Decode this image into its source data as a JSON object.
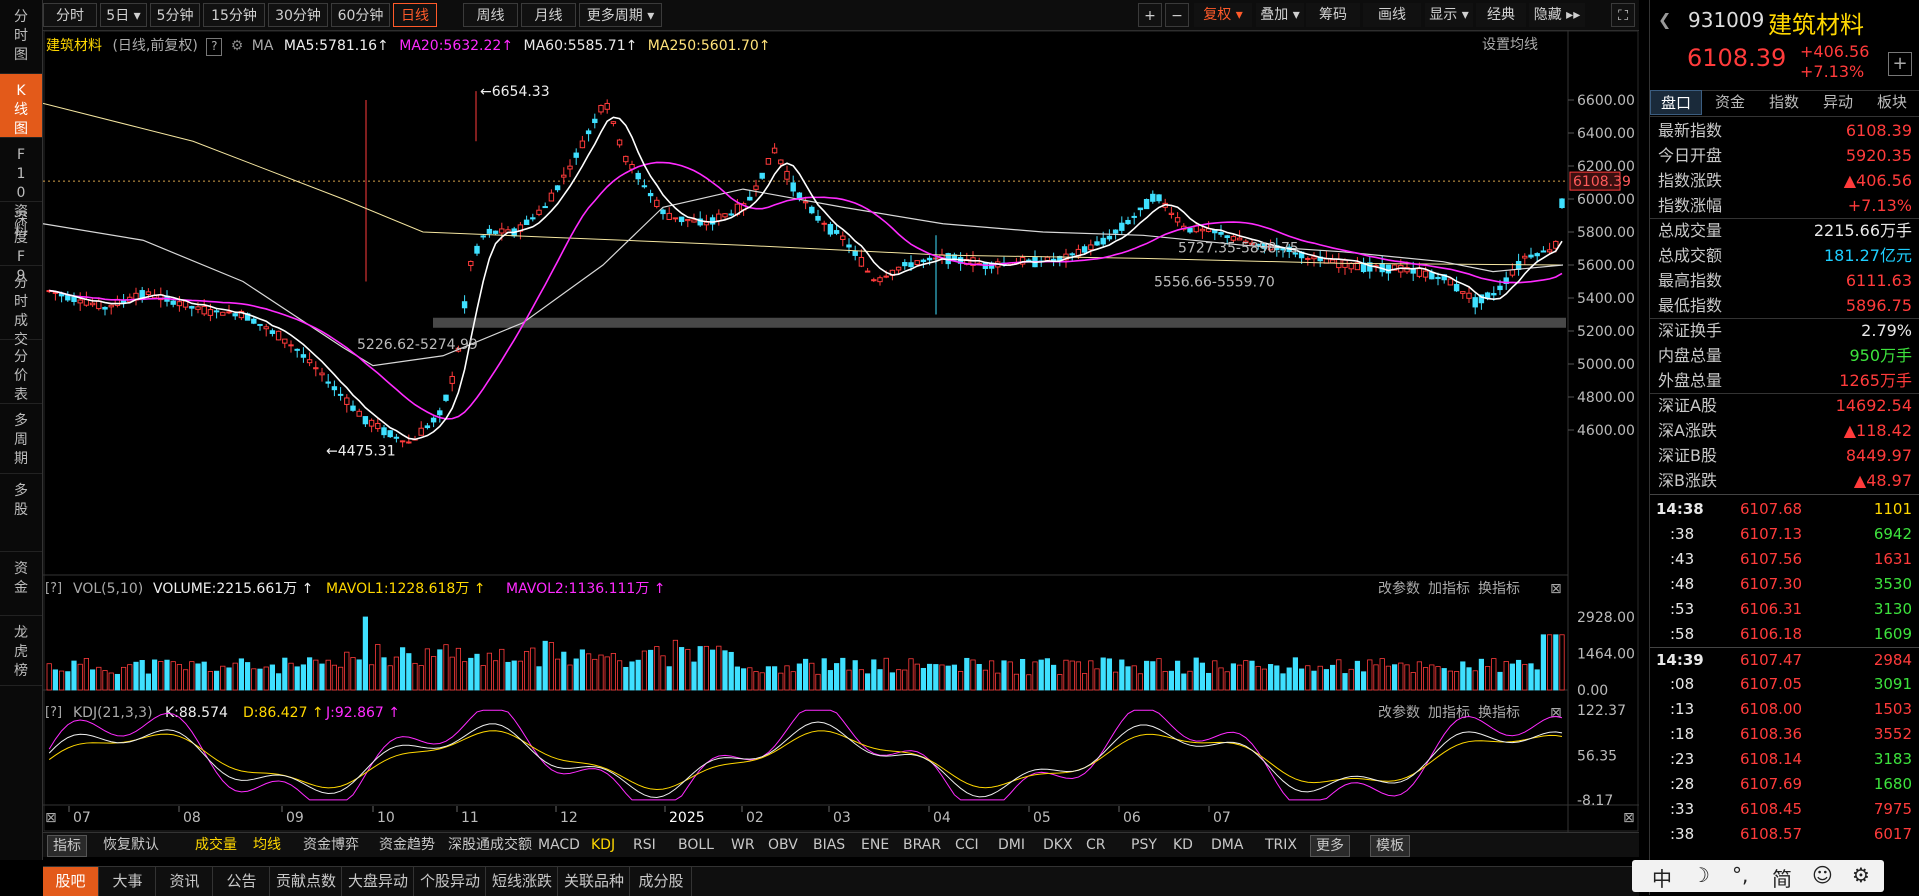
{
  "leftnav": [
    {
      "label": "分时图",
      "active": false
    },
    {
      "label": "K线图",
      "active": true
    },
    {
      "label": "F10资料",
      "active": false
    },
    {
      "label": "深度F9",
      "active": false
    },
    {
      "label": "分时成交",
      "active": false
    },
    {
      "label": "分价表",
      "active": false
    },
    {
      "label": "多周期",
      "active": false
    },
    {
      "label": "多股",
      "active": false
    },
    {
      "label": "资金",
      "active": false
    },
    {
      "label": "龙虎榜",
      "active": false
    }
  ],
  "toolbar": {
    "periods": [
      "分时",
      "5日",
      "5分钟",
      "15分钟",
      "30分钟",
      "60分钟",
      "日线",
      "周线",
      "月线",
      "更多周期"
    ],
    "active_period": "日线",
    "right": [
      "复权",
      "叠加",
      "筹码",
      "画线",
      "显示",
      "经典",
      "隐藏"
    ]
  },
  "header": {
    "name": "建筑材料",
    "mode": "(日线,前复权)",
    "ma_label": "MA",
    "ma5": "MA5:5781.16",
    "ma20": "MA20:5632.22",
    "ma60": "MA60:5585.71",
    "ma250": "MA250:5601.70",
    "set_ma": "设置均线"
  },
  "price_axis": [
    "6600.00",
    "6400.00",
    "6200.00",
    "6000.00",
    "5800.00",
    "5600.00",
    "5400.00",
    "5200.00",
    "5000.00",
    "4800.00",
    "4600.00"
  ],
  "current_price_tag": "6108.39",
  "annotations": {
    "high": "6654.33",
    "low": "4475.31",
    "zone": "5226.62-5274.99",
    "band1": "5727.35-5898.75",
    "band2": "5556.66-5559.70"
  },
  "volume": {
    "title": "VOL(5,10)",
    "volume": "VOLUME:2215.661万",
    "mavol1": "MAVOL1:1228.618万",
    "mavol2": "MAVOL2:1136.111万",
    "axis": [
      "2928.00",
      "1464.00",
      "0.00"
    ],
    "tools": [
      "改参数",
      "加指标",
      "换指标"
    ]
  },
  "kdj": {
    "title": "KDJ(21,3,3)",
    "k": "K:88.574",
    "d": "D:86.427",
    "j": "J:92.867",
    "axis": [
      "122.37",
      "56.35",
      "-8.17"
    ],
    "tools": [
      "改参数",
      "加指标",
      "换指标"
    ]
  },
  "xaxis": [
    "07",
    "08",
    "09",
    "10",
    "11",
    "12",
    "2025",
    "02",
    "03",
    "04",
    "05",
    "06",
    "07"
  ],
  "indicator_tabs": [
    "指标",
    "恢复默认",
    "成交量",
    "均线",
    "资金博弈",
    "资金趋势",
    "深股通成交额",
    "MACD",
    "KDJ",
    "RSI",
    "BOLL",
    "WR",
    "OBV",
    "BIAS",
    "ENE",
    "BRAR",
    "CCI",
    "DMI",
    "DKX",
    "CR",
    "PSY",
    "KD",
    "DMA",
    "TRIX",
    "更多",
    "模板"
  ],
  "bottom_tabs": [
    "股吧",
    "大事",
    "资讯",
    "公告",
    "贡献点数",
    "大盘异动",
    "个股异动",
    "短线涨跌",
    "关联品种",
    "成分股"
  ],
  "quote": {
    "code": "931009",
    "name": "建筑材料",
    "price": "6108.39",
    "change": "+406.56",
    "pct": "+7.13%",
    "tabs": [
      "盘口",
      "资金",
      "指数",
      "异动",
      "板块"
    ],
    "rows": [
      {
        "k": "最新指数",
        "v": "6108.39",
        "c": "red"
      },
      {
        "k": "今日开盘",
        "v": "5920.35",
        "c": "red"
      },
      {
        "k": "指数涨跌",
        "v": "▲406.56",
        "c": "red"
      },
      {
        "k": "指数涨幅",
        "v": "+7.13%",
        "c": "red"
      },
      {
        "k": "总成交量",
        "v": "2215.66万手",
        "c": "white"
      },
      {
        "k": "总成交额",
        "v": "181.27亿元",
        "c": "cyan"
      },
      {
        "k": "最高指数",
        "v": "6111.63",
        "c": "red"
      },
      {
        "k": "最低指数",
        "v": "5896.75",
        "c": "red"
      },
      {
        "k": "深证换手",
        "v": "2.79%",
        "c": "white"
      },
      {
        "k": "内盘总量",
        "v": "950万手",
        "c": "green"
      },
      {
        "k": "外盘总量",
        "v": "1265万手",
        "c": "red"
      },
      {
        "k": "深证A股",
        "v": "14692.54",
        "c": "red"
      },
      {
        "k": "深A涨跌",
        "v": "▲118.42",
        "c": "red"
      },
      {
        "k": "深证B股",
        "v": "8449.97",
        "c": "red"
      },
      {
        "k": "深B涨跌",
        "v": "▲48.97",
        "c": "red"
      }
    ],
    "ticks": [
      {
        "t": "14:38",
        "p": "6107.68",
        "v": "1101",
        "vc": "yellow",
        "bold": true
      },
      {
        "t": ":38",
        "p": "6107.13",
        "v": "6942",
        "vc": "green",
        "bold": false
      },
      {
        "t": ":43",
        "p": "6107.56",
        "v": "1631",
        "vc": "red",
        "bold": false
      },
      {
        "t": ":48",
        "p": "6107.30",
        "v": "3530",
        "vc": "green",
        "bold": false
      },
      {
        "t": ":53",
        "p": "6106.31",
        "v": "3130",
        "vc": "green",
        "bold": false
      },
      {
        "t": ":58",
        "p": "6106.18",
        "v": "1609",
        "vc": "green",
        "bold": false
      },
      {
        "t": "14:39",
        "p": "6107.47",
        "v": "2984",
        "vc": "red",
        "bold": true
      },
      {
        "t": ":08",
        "p": "6107.05",
        "v": "3091",
        "vc": "green",
        "bold": false
      },
      {
        "t": ":13",
        "p": "6108.00",
        "v": "1503",
        "vc": "red",
        "bold": false
      },
      {
        "t": ":18",
        "p": "6108.36",
        "v": "3552",
        "vc": "red",
        "bold": false
      },
      {
        "t": ":23",
        "p": "6108.14",
        "v": "3183",
        "vc": "green",
        "bold": false
      },
      {
        "t": ":28",
        "p": "6107.69",
        "v": "1680",
        "vc": "green",
        "bold": false
      },
      {
        "t": ":33",
        "p": "6108.45",
        "v": "7975",
        "vc": "red",
        "bold": false
      },
      {
        "t": ":38",
        "p": "6108.57",
        "v": "6017",
        "vc": "red",
        "bold": false
      }
    ]
  },
  "ime": [
    "中",
    "☽",
    "°,",
    "简",
    "☺",
    "⚙"
  ]
}
